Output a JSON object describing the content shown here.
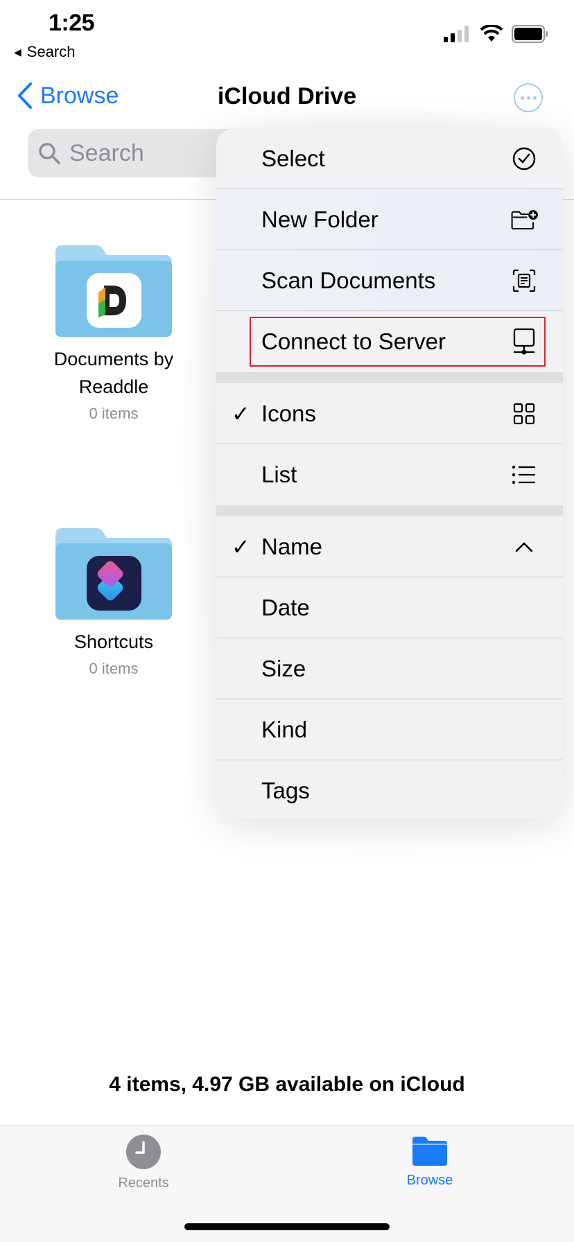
{
  "status": {
    "time": "1:25",
    "back_app": "Search"
  },
  "nav": {
    "back_label": "Browse",
    "title": "iCloud Drive"
  },
  "search": {
    "placeholder": "Search"
  },
  "folders": [
    {
      "name_line1": "Documents by",
      "name_line2": "Readdle",
      "count": "0 items"
    },
    {
      "name": "Shortcuts",
      "count": "0 items"
    }
  ],
  "menu": {
    "actions": [
      "Select",
      "New Folder",
      "Scan Documents",
      "Connect to Server"
    ],
    "view": [
      "Icons",
      "List"
    ],
    "sort": [
      "Name",
      "Date",
      "Size",
      "Kind",
      "Tags"
    ],
    "check_mark": "✓",
    "selected_view": "Icons",
    "selected_sort": "Name"
  },
  "footer": {
    "storage": "4 items, 4.97 GB available on iCloud"
  },
  "tabs": {
    "recents": "Recents",
    "browse": "Browse"
  },
  "colors": {
    "accent": "#1a7cf5",
    "highlight": "#e0212b",
    "folder": "#7cc3ea"
  }
}
